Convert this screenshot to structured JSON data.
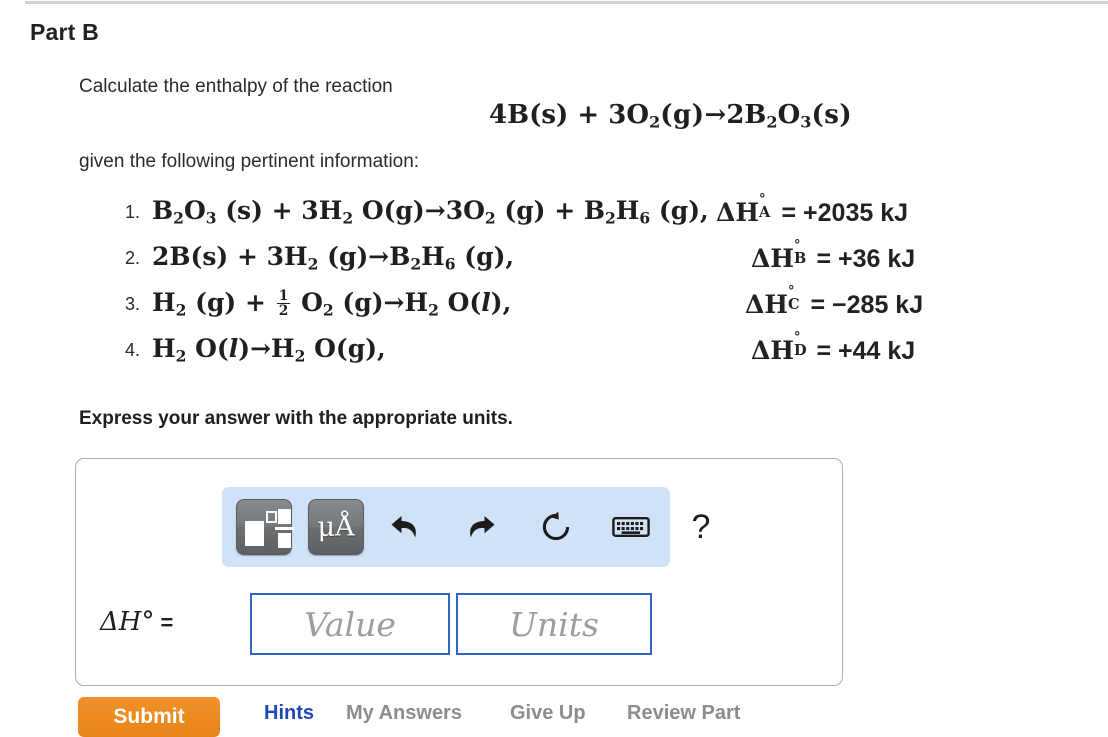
{
  "part": {
    "title": "Part B"
  },
  "prompt": {
    "line1": "Calculate the enthalpy of the reaction",
    "line2": "given the following pertinent information:",
    "instruction": "Express your answer with the appropriate units."
  },
  "target_reaction": {
    "coef_b": "4",
    "b": "B",
    "b_state": "(s)",
    "plus": "+",
    "coef_o2": "3",
    "o": "O",
    "o_sub": "2",
    "o_state": "(g)",
    "arrow": "→",
    "coef_prod": "2",
    "p_b": "B",
    "p_b_sub": "2",
    "p_o": "O",
    "p_o_sub": "3",
    "p_state": "(s)"
  },
  "reactions": [
    {
      "number": "1.",
      "equation_plain": "B2O3 (s) + 3H2O(g)→3O2 (g) + B2H6 (g),",
      "delta_label": "ΔH",
      "delta_sub": "A",
      "delta_deg": "°",
      "equals": "=",
      "value": "+2035 kJ"
    },
    {
      "number": "2.",
      "equation_plain": "2B(s) + 3H2 (g)→B2H6 (g),",
      "delta_label": "ΔH",
      "delta_sub": "B",
      "delta_deg": "°",
      "equals": "=",
      "value": "+36 kJ"
    },
    {
      "number": "3.",
      "equation_plain": "H2 (g) + 1/2 O2 (g)→H2O(l),",
      "delta_label": "ΔH",
      "delta_sub": "C",
      "delta_deg": "°",
      "equals": "=",
      "value": "−285 kJ"
    },
    {
      "number": "4.",
      "equation_plain": "H2O(l)→H2O(g),",
      "delta_label": "ΔH",
      "delta_sub": "D",
      "delta_deg": "°",
      "equals": "=",
      "value": "+44 kJ"
    }
  ],
  "toolbar": {
    "template_button_name": "math-template-button",
    "units_button_label": "μÅ",
    "undo_icon": "undo-arrow-icon",
    "redo_icon": "redo-arrow-icon",
    "reset_icon": "reset-circular-arrow-icon",
    "keyboard_icon": "keyboard-icon",
    "help_label": "?",
    "background_color": "#cfe2f7"
  },
  "answer": {
    "label_delta": "ΔH",
    "label_deg": "°",
    "label_equals": "=",
    "value_placeholder": "Value",
    "units_placeholder": "Units",
    "value_text": "",
    "units_text": "",
    "border_color": "#2f66c0"
  },
  "actions": {
    "submit_label": "Submit",
    "submit_color": "#ec8a1f",
    "hints_label": "Hints",
    "hints_color": "#1f47b5",
    "my_answers_label": "My Answers",
    "give_up_label": "Give Up",
    "review_part_label": "Review Part",
    "muted_color": "#8c8c8c"
  }
}
